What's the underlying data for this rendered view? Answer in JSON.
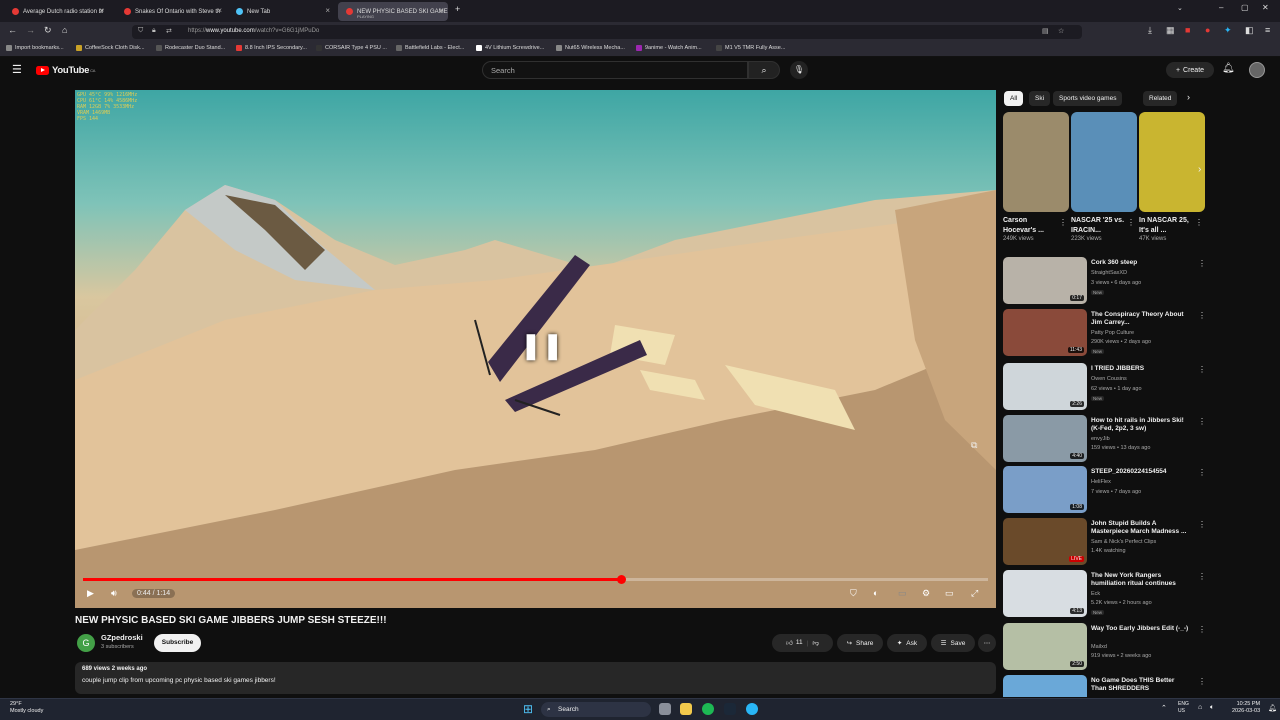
{
  "browser": {
    "tabs": [
      {
        "label": "Average Dutch radio station br",
        "color": "#e53935"
      },
      {
        "label": "Snakes Of Ontario with Steve th",
        "color": "#e53935"
      },
      {
        "label": "New Tab",
        "color": "#4fc3f7"
      },
      {
        "label": "NEW PHYSIC BASED SKI GAME",
        "sub": "PLAYING",
        "color": "#e53935"
      }
    ],
    "url_prefix": "https://",
    "url_domain": "www.youtube.com",
    "url_rest": "/watch?v=G6G1jMPuDo",
    "bookmarks": [
      {
        "label": "Import bookmarks...",
        "color": "#888"
      },
      {
        "label": "CoffeeSock Cloth Disk...",
        "color": "#c9a227"
      },
      {
        "label": "Rodecaster Duo Stand...",
        "color": "#555"
      },
      {
        "label": "8.8 Inch IPS Secondary...",
        "color": "#e53935"
      },
      {
        "label": "CORSAIR Type 4 PSU ...",
        "color": "#333"
      },
      {
        "label": "Battlefield Labs - Elect...",
        "color": "#666"
      },
      {
        "label": "4V Lithium Screwdrive...",
        "color": "#fff"
      },
      {
        "label": "Nut65 Wireless Mecha...",
        "color": "#888"
      },
      {
        "label": "9anime - Watch Anim...",
        "color": "#9c27b0"
      },
      {
        "label": "M1 V5 TMR Fully Asse...",
        "color": "#444"
      }
    ]
  },
  "youtube": {
    "logo": "YouTube",
    "region": "CA",
    "search_placeholder": "Search",
    "create_label": "Create"
  },
  "player": {
    "stats_lines": [
      "GPU   45°C   99%   1216MHz",
      "CPU   61°C   14%   4586MHz",
      "RAM   12GB   7%    3533MHz",
      "VRAM  1469MB",
      "FPS   144"
    ],
    "time_label": "0:44 / 1:14",
    "progress": 0.5946,
    "stats_color": "#ddcc55"
  },
  "video": {
    "title": "NEW PHYSIC BASED SKI GAME JIBBERS JUMP SESH STEEZE!!!",
    "channel": "GZpedroski",
    "channel_initial": "G",
    "subscribers": "3 subscribers",
    "subscribe_label": "Subscribe",
    "likes": "11",
    "share_label": "Share",
    "ask_label": "Ask",
    "save_label": "Save",
    "desc_meta": "689 views  2 weeks ago",
    "desc_text": "couple jump clip from upcoming pc physic based ski games jibbers!"
  },
  "chips": [
    "All",
    "Ski",
    "Sports video games",
    "Related"
  ],
  "shorts": [
    {
      "title": "Carson Hocevar's ...",
      "views": "249K views",
      "color": "#9b8b6b"
    },
    {
      "title": "NASCAR '25 vs. IRACIN...",
      "views": "223K views",
      "color": "#5a8fb8"
    },
    {
      "title": "In NASCAR 25, It's all ...",
      "views": "47K views",
      "color": "#c9b530"
    }
  ],
  "recommendations": [
    {
      "title": "Cork 360 steep",
      "channel": "StraightSaxXD",
      "views": "3 views • 6 days ago",
      "badge": "New",
      "duration": "0:17",
      "color": "#b8b2a8"
    },
    {
      "title": "The Conspiracy Theory About Jim Carrey...",
      "channel": "Patty Pop Culture",
      "views": "290K views • 2 days ago",
      "badge": "New",
      "duration": "11:43",
      "color": "#8a4a3a"
    },
    {
      "title": "I TRIED JIBBERS",
      "channel": "Owen Cousins",
      "views": "62 views • 1 day ago",
      "badge": "New",
      "duration": "2:26",
      "color": "#cfd6da"
    },
    {
      "title": "How to hit rails in Jibbers Ski! (K-Fed, 2p2, 3 sw)",
      "channel": "envyJib",
      "views": "159 views • 13 days ago",
      "badge": "",
      "duration": "4:40",
      "color": "#8a9aa6"
    },
    {
      "title": "STEEP_20260224154554",
      "channel": "HeliFlex",
      "views": "7 views • 7 days ago",
      "badge": "",
      "duration": "1:08",
      "color": "#7a9ec8"
    },
    {
      "title": "John Stupid Builds A Masterpiece March Madness ...",
      "channel": "Sam & Nick's Perfect Clips",
      "views": "1.4K watching",
      "badge": "LIVE",
      "duration": "",
      "color": "#6a4a2a"
    },
    {
      "title": "The New York Rangers humiliation ritual continues",
      "channel": "Eck",
      "views": "5.2K views • 2 hours ago",
      "badge": "New",
      "duration": "4:13",
      "color": "#d8dde2"
    },
    {
      "title": "Way Too Early Jibbers Edit (-_-)",
      "channel": "Mailxd",
      "views": "919 views • 2 weeks ago",
      "badge": "",
      "duration": "2:50",
      "color": "#b5bfa5"
    },
    {
      "title": "No Game Does THIS Better Than SHREDDERS",
      "channel": "",
      "views": "",
      "badge": "",
      "duration": "",
      "color": "#6aa8d8"
    }
  ],
  "taskbar": {
    "weather_temp": "29°F",
    "weather_desc": "Mostly cloudy",
    "search_label": "Search",
    "lang1": "ENG",
    "lang2": "US",
    "time": "10:25 PM",
    "date": "2026-03-03"
  },
  "colors": {
    "accent": "#ff0000",
    "bg": "#0f0f0f"
  }
}
